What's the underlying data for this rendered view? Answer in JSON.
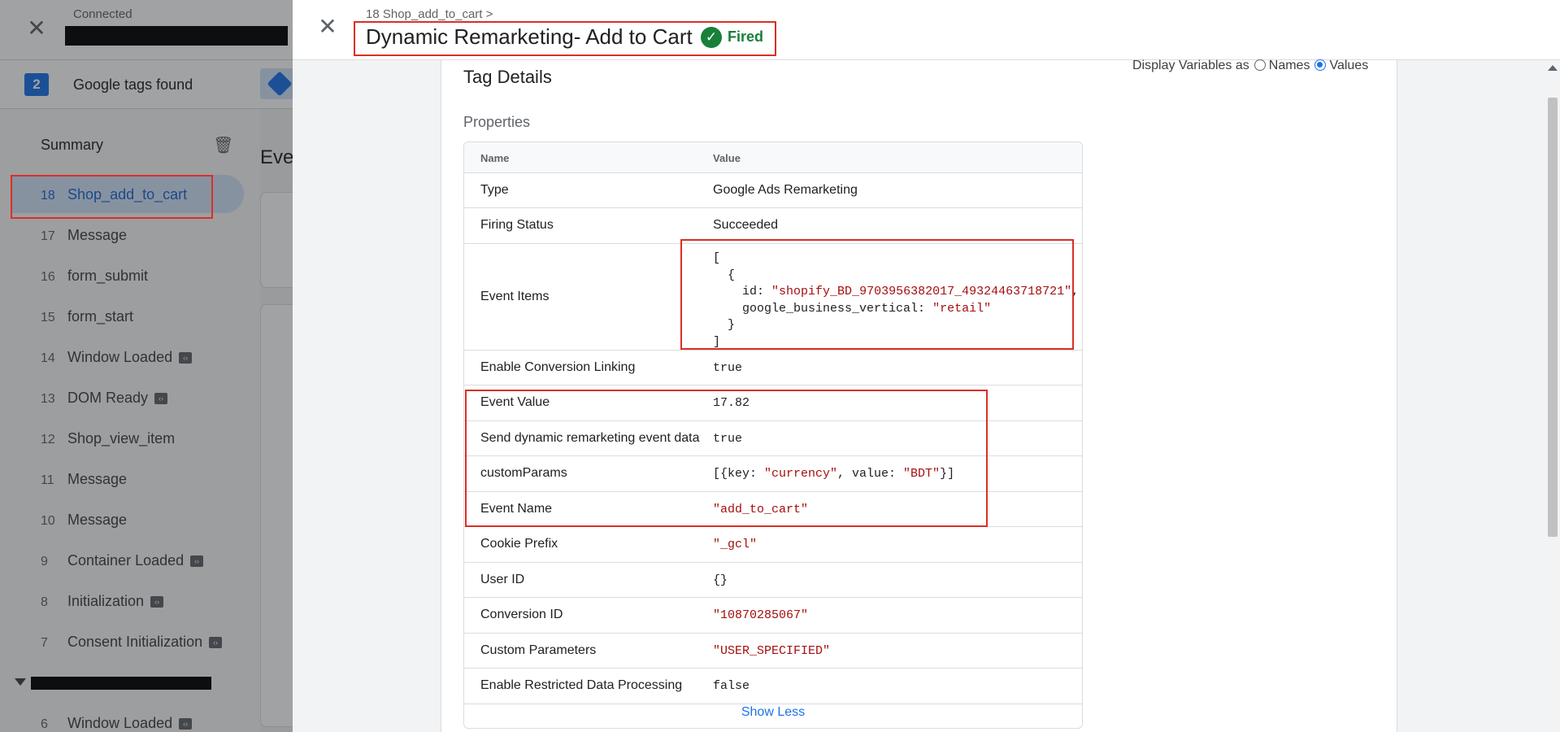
{
  "background": {
    "connected_label": "Connected",
    "tags_count": "2",
    "tags_found_label": "Google tags found",
    "sidebar_summary": "Summary",
    "main_title": "Eve",
    "events": [
      {
        "num": "18",
        "label": "Shop_add_to_cart",
        "badge": false
      },
      {
        "num": "17",
        "label": "Message",
        "badge": false
      },
      {
        "num": "16",
        "label": "form_submit",
        "badge": false
      },
      {
        "num": "15",
        "label": "form_start",
        "badge": false
      },
      {
        "num": "14",
        "label": "Window Loaded",
        "badge": true
      },
      {
        "num": "13",
        "label": "DOM Ready",
        "badge": true
      },
      {
        "num": "12",
        "label": "Shop_view_item",
        "badge": false
      },
      {
        "num": "11",
        "label": "Message",
        "badge": false
      },
      {
        "num": "10",
        "label": "Message",
        "badge": false
      },
      {
        "num": "9",
        "label": "Container Loaded",
        "badge": true
      },
      {
        "num": "8",
        "label": "Initialization",
        "badge": true
      },
      {
        "num": "7",
        "label": "Consent Initialization",
        "badge": true
      },
      {
        "num": "6",
        "label": "Window Loaded",
        "badge": true
      }
    ]
  },
  "panel": {
    "breadcrumb": "18 Shop_add_to_cart >",
    "title": "Dynamic Remarketing- Add to Cart",
    "status": "Fired",
    "tag_details_heading": "Tag Details",
    "display_vars_label": "Display Variables as",
    "display_vars_options": [
      "Names",
      "Values"
    ],
    "display_vars_selected": "Values",
    "properties_heading": "Properties",
    "table": {
      "header_name": "Name",
      "header_value": "Value",
      "type": {
        "name": "Type",
        "value": "Google Ads Remarketing"
      },
      "firing_status": {
        "name": "Firing Status",
        "value": "Succeeded"
      },
      "event_items": {
        "name": "Event Items",
        "open_bracket": "[",
        "open_brace": "{",
        "id_key": "id:",
        "id_value": "\"shopify_BD_9703956382017_49324463718721\"",
        "id_comma": ",",
        "vertical_key": "google_business_vertical:",
        "vertical_value": "\"retail\"",
        "close_brace": "}",
        "close_bracket": "]"
      },
      "enable_conversion_linking": {
        "name": "Enable Conversion Linking",
        "value": "true"
      },
      "event_value": {
        "name": "Event Value",
        "value": "17.82"
      },
      "send_dynamic": {
        "name": "Send dynamic remarketing event data",
        "value": "true"
      },
      "custom_params": {
        "name": "customParams",
        "part1": "[{key: ",
        "currency": "\"currency\"",
        "part2": ", value: ",
        "bdt": "\"BDT\"",
        "part3": "}]"
      },
      "event_name": {
        "name": "Event Name",
        "value": "\"add_to_cart\""
      },
      "cookie_prefix": {
        "name": "Cookie Prefix",
        "value": "\"_gcl\""
      },
      "user_id": {
        "name": "User ID",
        "value": "{}"
      },
      "conversion_id": {
        "name": "Conversion ID",
        "value": "\"10870285067\""
      },
      "custom_parameters": {
        "name": "Custom Parameters",
        "value": "\"USER_SPECIFIED\""
      },
      "restricted_data": {
        "name": "Enable Restricted Data Processing",
        "value": "false"
      }
    },
    "show_less": "Show Less"
  },
  "colors": {
    "accent": "#1a73e8",
    "fired_green": "#188038",
    "annotation_red": "#d93025",
    "string_red": "#a50e0e"
  }
}
